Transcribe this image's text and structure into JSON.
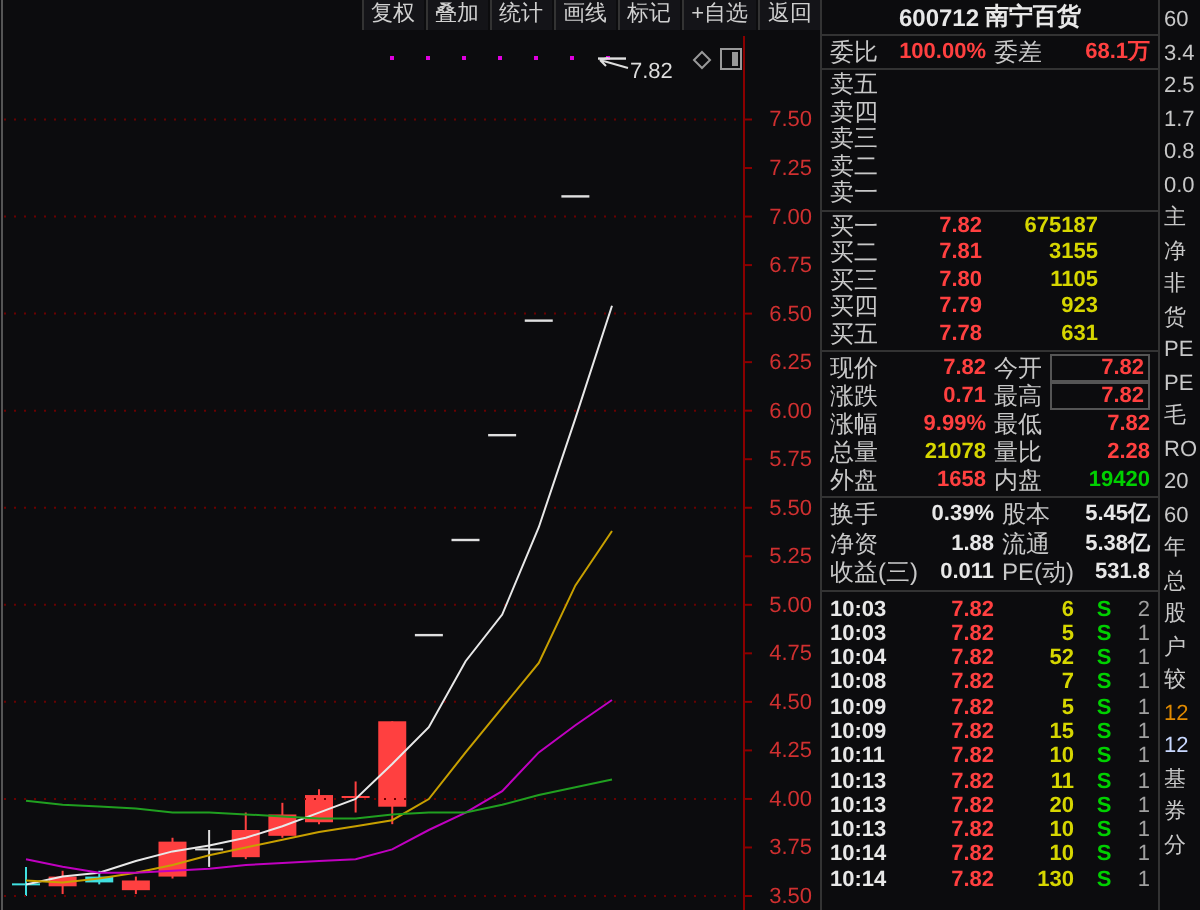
{
  "toolbar": [
    "复权",
    "叠加",
    "统计",
    "画线",
    "标记",
    "+自选",
    "返回"
  ],
  "chart": {
    "last_price_label": "7.82",
    "chart_data": {
      "type": "line",
      "categories": [
        null,
        null,
        null,
        null,
        null,
        null,
        null,
        null,
        null,
        null,
        null,
        null,
        null,
        null,
        null,
        null,
        null
      ],
      "ylim": [
        3.5,
        7.93
      ],
      "grid": true,
      "yticks": [
        {
          "value": 7.5,
          "label": "7.50"
        },
        {
          "value": 7.25,
          "label": "7.25"
        },
        {
          "value": 7.0,
          "label": "7.00"
        },
        {
          "value": 6.75,
          "label": "6.75"
        },
        {
          "value": 6.5,
          "label": "6.50"
        },
        {
          "value": 6.25,
          "label": "6.25"
        },
        {
          "value": 6.0,
          "label": "6.00"
        },
        {
          "value": 5.75,
          "label": "5.75"
        },
        {
          "value": 5.5,
          "label": "5.50"
        },
        {
          "value": 5.25,
          "label": "5.25"
        },
        {
          "value": 5.0,
          "label": "5.00"
        },
        {
          "value": 4.75,
          "label": "4.75"
        },
        {
          "value": 4.5,
          "label": "4.50"
        },
        {
          "value": 4.25,
          "label": "4.25"
        },
        {
          "value": 4.0,
          "label": "4.00"
        },
        {
          "value": 3.75,
          "label": "3.75"
        },
        {
          "value": 3.5,
          "label": "3.50"
        }
      ],
      "series": [
        {
          "color": "#e8e8e8",
          "values": [
            3.56,
            3.6,
            3.62,
            3.68,
            3.73,
            3.76,
            3.8,
            3.86,
            3.93,
            4.0,
            4.18,
            4.37,
            4.71,
            4.95,
            5.4,
            5.96,
            6.54
          ]
        },
        {
          "color": "#c8a000",
          "values": [
            3.58,
            3.57,
            3.59,
            3.62,
            3.66,
            3.71,
            3.75,
            3.79,
            3.83,
            3.86,
            3.89,
            4.0,
            4.24,
            4.47,
            4.7,
            5.1,
            5.38
          ]
        },
        {
          "color": "#c000c0",
          "values": [
            3.69,
            3.65,
            3.62,
            3.62,
            3.63,
            3.64,
            3.66,
            3.67,
            3.68,
            3.69,
            3.74,
            3.84,
            3.93,
            4.04,
            4.24,
            4.38,
            4.51
          ]
        },
        {
          "color": "#20a020",
          "values": [
            3.99,
            3.97,
            3.96,
            3.95,
            3.93,
            3.93,
            3.92,
            3.91,
            3.9,
            3.9,
            3.92,
            3.93,
            3.93,
            3.97,
            4.02,
            4.06,
            4.1
          ]
        }
      ]
    }
  },
  "quote_panel": {
    "code": "600712",
    "name": "南宁百货",
    "order_ratio": [
      {
        "label": "委比",
        "value": "100.00%",
        "color": "#ff4040"
      },
      {
        "label": "委差",
        "value": "68.1万",
        "color": "#ff4040"
      }
    ],
    "asks": [
      {
        "label": "卖五"
      },
      {
        "label": "卖四"
      },
      {
        "label": "卖三"
      },
      {
        "label": "卖二"
      },
      {
        "label": "卖一"
      }
    ],
    "bids": [
      {
        "label": "买一",
        "price": "7.82",
        "volume": "675187"
      },
      {
        "label": "买二",
        "price": "7.81",
        "volume": "3155"
      },
      {
        "label": "买三",
        "price": "7.80",
        "volume": "1105"
      },
      {
        "label": "买四",
        "price": "7.79",
        "volume": "923"
      },
      {
        "label": "买五",
        "price": "7.78",
        "volume": "631"
      }
    ],
    "quote": [
      {
        "label": "现价",
        "value": "7.82",
        "color": "#ff4040",
        "boxed": false
      },
      {
        "label": "今开",
        "value": "7.82",
        "color": "#ff4040",
        "boxed": true
      },
      {
        "label": "涨跌",
        "value": "0.71",
        "color": "#ff4040",
        "boxed": false
      },
      {
        "label": "最高",
        "value": "7.82",
        "color": "#ff4040",
        "boxed": true
      },
      {
        "label": "涨幅",
        "value": "9.99%",
        "color": "#ff4040",
        "boxed": false
      },
      {
        "label": "最低",
        "value": "7.82",
        "color": "#ff4040",
        "boxed": false
      },
      {
        "label": "总量",
        "value": "21078",
        "color": "#d6d600",
        "boxed": false
      },
      {
        "label": "量比",
        "value": "2.28",
        "color": "#ff4040",
        "boxed": false
      },
      {
        "label": "外盘",
        "value": "1658",
        "color": "#ff4040",
        "boxed": false
      },
      {
        "label": "内盘",
        "value": "19420",
        "color": "#00d000",
        "boxed": false
      }
    ],
    "fundamentals": [
      {
        "label": "换手",
        "value": "0.39%"
      },
      {
        "label": "股本",
        "value": "5.45亿"
      },
      {
        "label": "净资",
        "value": "1.88"
      },
      {
        "label": "流通",
        "value": "5.38亿"
      },
      {
        "label": "收益(三)",
        "value": "0.011"
      },
      {
        "label": "PE(动)",
        "value": "531.8"
      }
    ],
    "trades": [
      {
        "time": "10:03",
        "price": "7.82",
        "volume": "6",
        "side": "S",
        "count": "2"
      },
      {
        "time": "10:03",
        "price": "7.82",
        "volume": "5",
        "side": "S",
        "count": "1"
      },
      {
        "time": "10:04",
        "price": "7.82",
        "volume": "52",
        "side": "S",
        "count": "1"
      },
      {
        "time": "10:08",
        "price": "7.82",
        "volume": "7",
        "side": "S",
        "count": "1"
      },
      {
        "time": "10:09",
        "price": "7.82",
        "volume": "5",
        "side": "S",
        "count": "1"
      },
      {
        "time": "10:09",
        "price": "7.82",
        "volume": "15",
        "side": "S",
        "count": "1"
      },
      {
        "time": "10:11",
        "price": "7.82",
        "volume": "10",
        "side": "S",
        "count": "1"
      },
      {
        "time": "10:13",
        "price": "7.82",
        "volume": "11",
        "side": "S",
        "count": "1"
      },
      {
        "time": "10:13",
        "price": "7.82",
        "volume": "20",
        "side": "S",
        "count": "1"
      },
      {
        "time": "10:13",
        "price": "7.82",
        "volume": "10",
        "side": "S",
        "count": "1"
      },
      {
        "time": "10:14",
        "price": "7.82",
        "volume": "10",
        "side": "S",
        "count": "1"
      },
      {
        "time": "10:14",
        "price": "7.82",
        "volume": "130",
        "side": "S",
        "count": "1"
      }
    ]
  },
  "side_strip": [
    {
      "text": "60",
      "color": "#c8c8c8"
    },
    {
      "text": "3.4",
      "color": "#c8c8c8"
    },
    {
      "text": "2.5",
      "color": "#c8c8c8"
    },
    {
      "text": "1.7",
      "color": "#c8c8c8"
    },
    {
      "text": "0.8",
      "color": "#c8c8c8"
    },
    {
      "text": "0.0",
      "color": "#c8c8c8"
    },
    {
      "text": "主",
      "color": "#c8c8c8"
    },
    {
      "text": "净",
      "color": "#c8c8c8"
    },
    {
      "text": "非",
      "color": "#c8c8c8"
    },
    {
      "text": "货",
      "color": "#c8c8c8"
    },
    {
      "text": "PE",
      "color": "#c8c8c8"
    },
    {
      "text": "PE",
      "color": "#c8c8c8"
    },
    {
      "text": "毛",
      "color": "#c8c8c8"
    },
    {
      "text": "RO",
      "color": "#c8c8c8"
    },
    {
      "text": "20",
      "color": "#c8c8c8"
    },
    {
      "text": "60",
      "color": "#c8c8c8"
    },
    {
      "text": "年",
      "color": "#c8c8c8"
    },
    {
      "text": "总",
      "color": "#c8c8c8"
    },
    {
      "text": "股",
      "color": "#c8c8c8"
    },
    {
      "text": "户",
      "color": "#c8c8c8"
    },
    {
      "text": "较",
      "color": "#c8c8c8"
    },
    {
      "text": "12",
      "color": "#e08a00"
    },
    {
      "text": "12",
      "color": "#c8d8ff"
    },
    {
      "text": "基",
      "color": "#c8c8c8"
    },
    {
      "text": "券",
      "color": "#c8c8c8"
    },
    {
      "text": "分",
      "color": "#c8c8c8"
    }
  ]
}
